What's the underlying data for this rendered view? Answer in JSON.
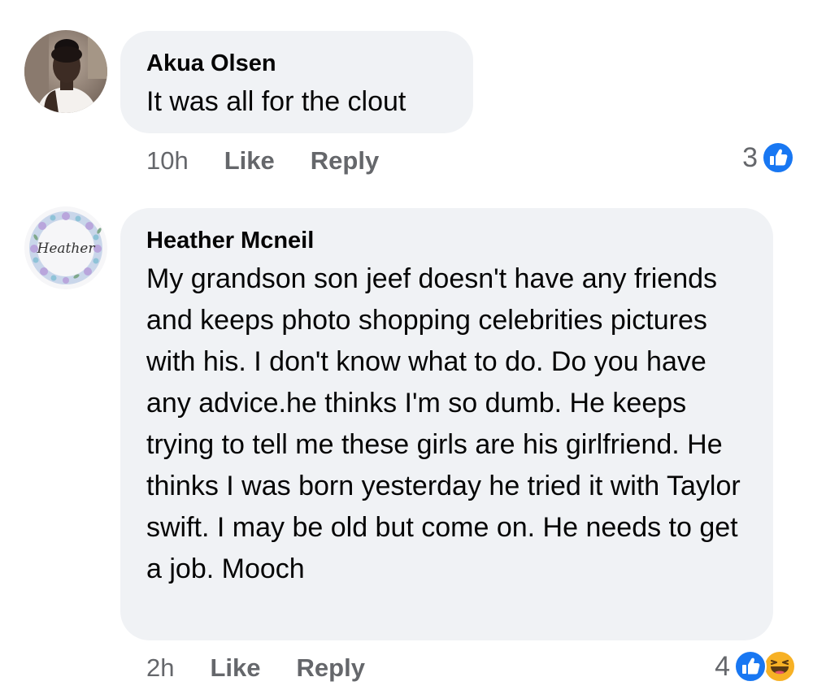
{
  "comments": [
    {
      "author": "Akua Olsen",
      "text": "It was all for the clout",
      "time": "10h",
      "like_label": "Like",
      "reply_label": "Reply",
      "reaction_count": "3",
      "reactions": [
        "like"
      ]
    },
    {
      "author": "Heather Mcneil",
      "avatar_text": "Heather",
      "text": "My grandson son jeef doesn't have any friends and keeps photo shopping celebrities pictures with his. I don't know what to do. Do you have any advice.he thinks I'm so dumb. He keeps trying to tell me these girls are his girlfriend. He thinks I was born yesterday he tried it with Taylor swift. I may be old but come on. He needs to get a job. Mooch",
      "time": "2h",
      "like_label": "Like",
      "reply_label": "Reply",
      "reaction_count": "4",
      "reactions": [
        "like",
        "haha"
      ]
    }
  ],
  "colors": {
    "bubble": "#f0f2f5",
    "meta_text": "#65676b",
    "like_blue": "#1877f2",
    "haha_yellow": "#f7b125"
  }
}
